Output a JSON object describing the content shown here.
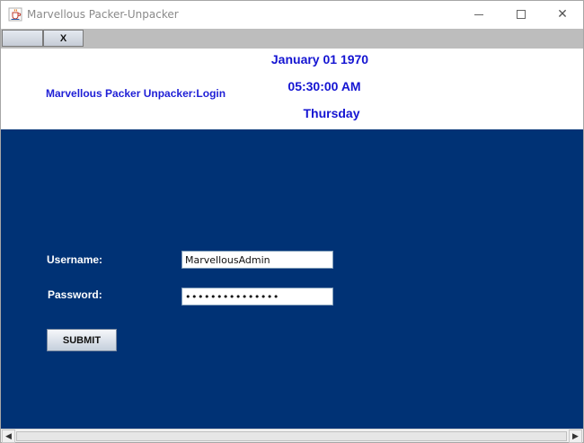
{
  "window": {
    "title": "Marvellous Packer-Unpacker",
    "icon": "java-coffee-icon",
    "controls": {
      "minimize": "minimize-icon",
      "maximize": "maximize-icon",
      "close_glyph": "✕"
    }
  },
  "toolbar": {
    "blank_label": "",
    "x_label": "X"
  },
  "header": {
    "login_title": "Marvellous Packer Unpacker:Login",
    "date": "January 01 1970",
    "time": "05:30:00 AM",
    "day": "Thursday"
  },
  "form": {
    "username_label": "Username:",
    "username_value": "MarvellousAdmin",
    "password_label": "Password:",
    "password_value": "•••••••••••••••",
    "submit_label": "SUBMIT"
  },
  "scrollbar": {
    "left_arrow": "◀",
    "right_arrow": "▶"
  },
  "colors": {
    "main_background": "#003275",
    "header_text": "#1414d2"
  }
}
